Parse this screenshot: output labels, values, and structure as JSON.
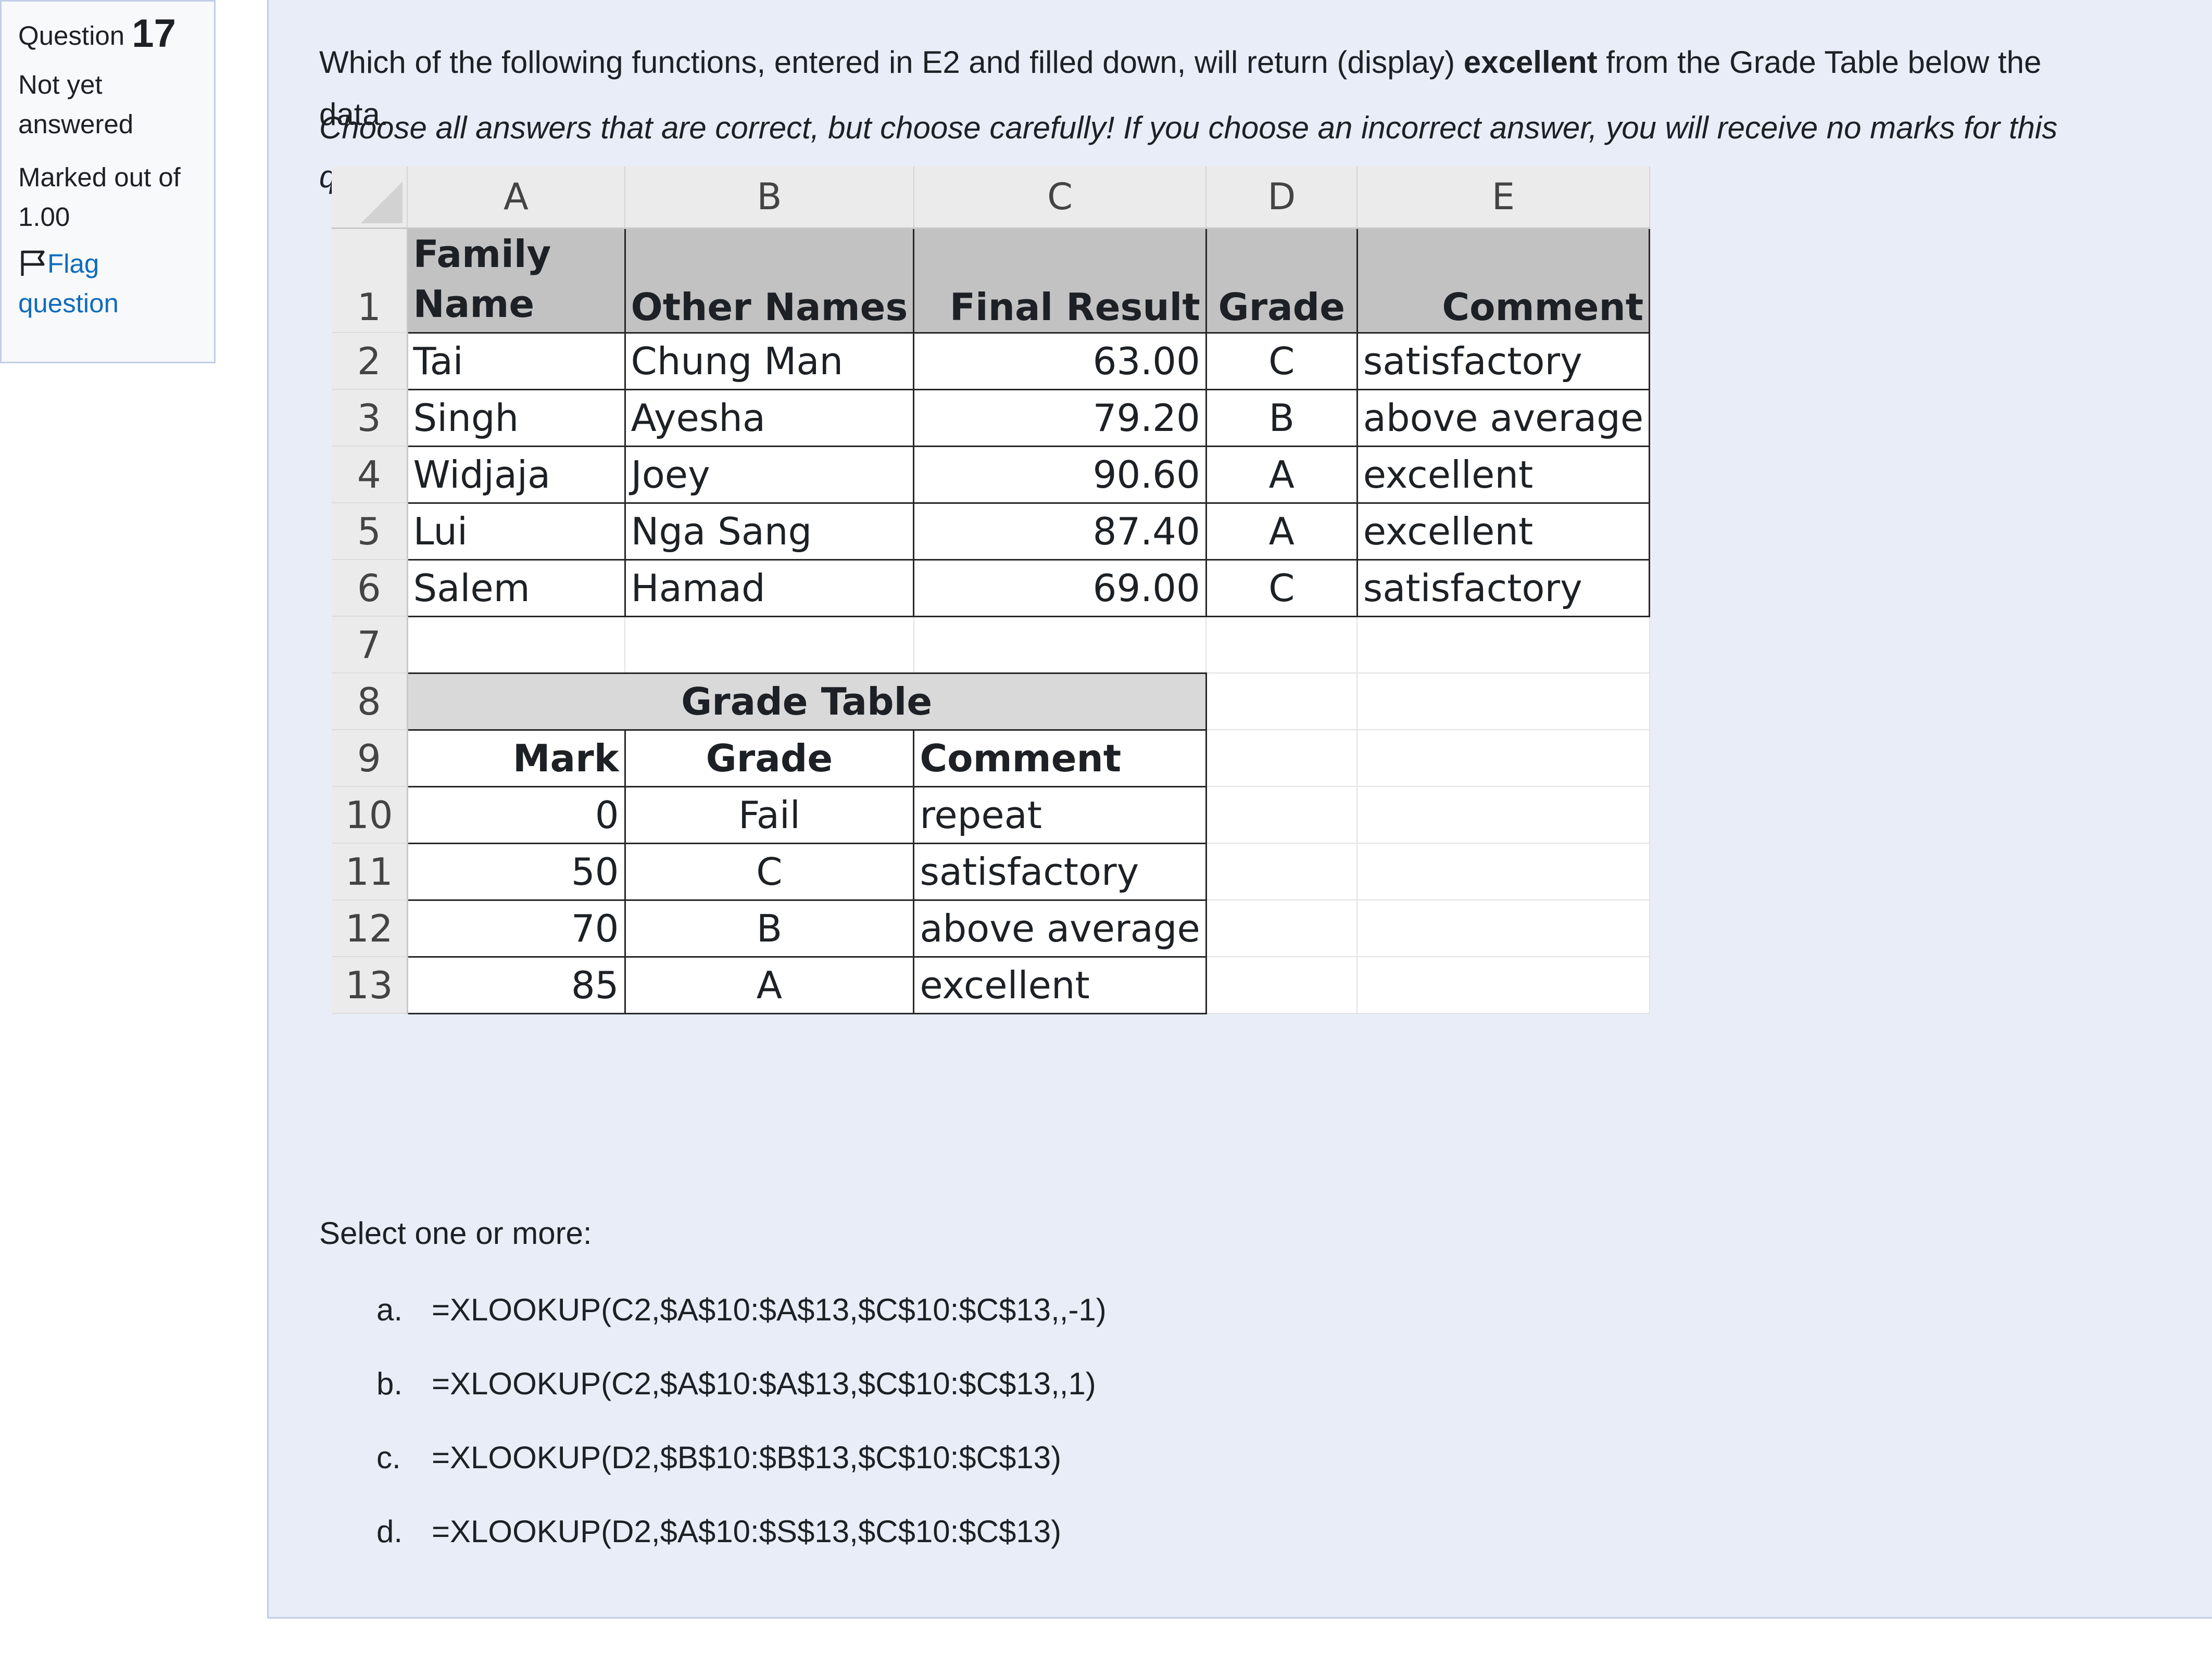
{
  "info": {
    "question_label": "Question",
    "question_number": "17",
    "state": "Not yet answered",
    "grade": "Marked out of 1.00",
    "flag_label": "Flag question"
  },
  "question": {
    "text_before": "Which of the following functions, entered in E2 and filled down, will return (display) ",
    "text_bold": "excellent",
    "text_after": " from the Grade Table below the",
    "text_overflow": "data.",
    "instruction": "Choose all answers that are correct, but choose carefully! If you choose an incorrect answer, you will receive no marks for this",
    "instruction_overflow": "q"
  },
  "sheet": {
    "columns": [
      "A",
      "B",
      "C",
      "D",
      "E"
    ],
    "rows": [
      "1",
      "2",
      "3",
      "4",
      "5",
      "6",
      "7",
      "8",
      "9",
      "10",
      "11",
      "12",
      "13"
    ],
    "headers": {
      "family_name_1": "Family",
      "family_name_2": "Name",
      "other_names": "Other Names",
      "final_result": "Final Result",
      "grade": "Grade",
      "comment": "Comment"
    },
    "data": [
      {
        "family": "Tai",
        "other": "Chung Man",
        "result": "63.00",
        "grade": "C",
        "comment": "satisfactory"
      },
      {
        "family": "Singh",
        "other": "Ayesha",
        "result": "79.20",
        "grade": "B",
        "comment": "above average"
      },
      {
        "family": "Widjaja",
        "other": "Joey",
        "result": "90.60",
        "grade": "A",
        "comment": "excellent"
      },
      {
        "family": "Lui",
        "other": "Nga Sang",
        "result": "87.40",
        "grade": "A",
        "comment": "excellent"
      },
      {
        "family": "Salem",
        "other": "Hamad",
        "result": "69.00",
        "grade": "C",
        "comment": "satisfactory"
      }
    ],
    "grade_table": {
      "title": "Grade Table",
      "headers": [
        "Mark",
        "Grade",
        "Comment"
      ],
      "rows": [
        {
          "mark": "0",
          "grade": "Fail",
          "comment": "repeat"
        },
        {
          "mark": "50",
          "grade": "C",
          "comment": "satisfactory"
        },
        {
          "mark": "70",
          "grade": "B",
          "comment": "above average"
        },
        {
          "mark": "85",
          "grade": "A",
          "comment": "excellent"
        }
      ]
    }
  },
  "answers": {
    "prompt": "Select one or more:",
    "options": [
      {
        "letter": "a.",
        "text": "=XLOOKUP(C2,$A$10:$A$13,$C$10:$C$13,,-1)"
      },
      {
        "letter": "b.",
        "text": "=XLOOKUP(C2,$A$10:$A$13,$C$10:$C$13,,1)"
      },
      {
        "letter": "c.",
        "text": "=XLOOKUP(D2,$B$10:$B$13,$C$10:$C$13)"
      },
      {
        "letter": "d.",
        "text": "=XLOOKUP(D2,$A$10:$S$13,$C$10:$C$13)"
      }
    ]
  }
}
